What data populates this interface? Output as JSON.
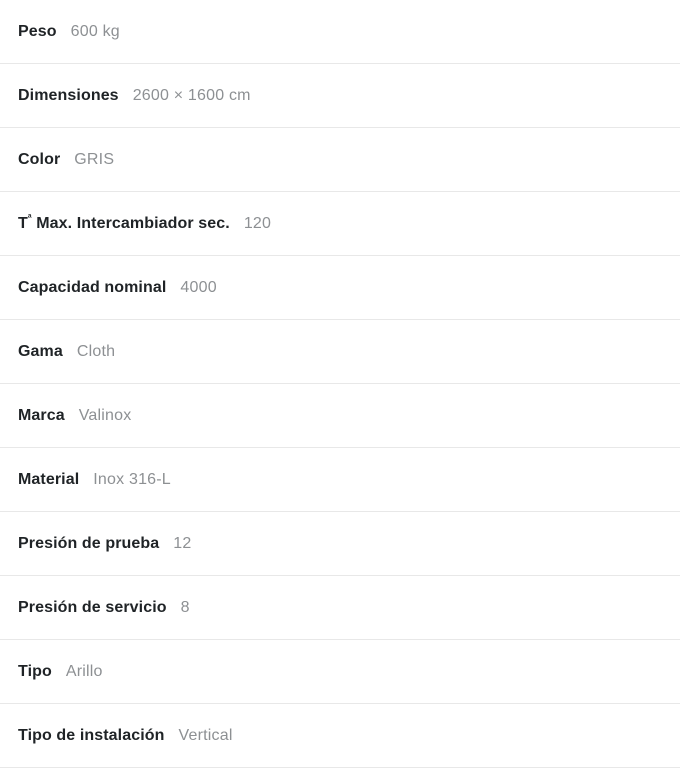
{
  "spec_sheet": {
    "divider_color": "#e8e8e8",
    "label_color": "#1f2326",
    "value_color": "#8d9093",
    "rows": [
      {
        "label": "Peso",
        "value": "600 kg"
      },
      {
        "label": "Dimensiones",
        "value": "2600 × 1600 cm"
      },
      {
        "label": "Color",
        "value": "GRIS"
      },
      {
        "label": "Tª Max. Intercambiador sec.",
        "label_base": "T",
        "label_sup": "ª",
        "label_rest": " Max. Intercambiador sec.",
        "value": "120"
      },
      {
        "label": "Capacidad nominal",
        "value": "4000"
      },
      {
        "label": "Gama",
        "value": "Cloth"
      },
      {
        "label": "Marca",
        "value": "Valinox"
      },
      {
        "label": "Material",
        "value": "Inox 316-L"
      },
      {
        "label": "Presión de prueba",
        "value": "12"
      },
      {
        "label": "Presión de servicio",
        "value": "8"
      },
      {
        "label": "Tipo",
        "value": "Arillo"
      },
      {
        "label": "Tipo de instalación",
        "value": "Vertical"
      }
    ]
  }
}
